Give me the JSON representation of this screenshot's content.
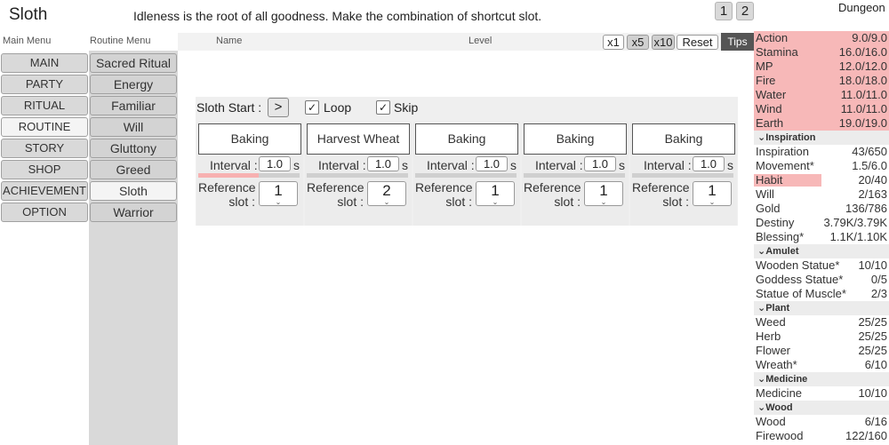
{
  "title": "Sloth",
  "description": "Idleness is the root of all goodness. Make the combination of shortcut slot.",
  "pages": [
    "1",
    "2"
  ],
  "location": "Dungeon",
  "header": {
    "name": "Name",
    "level": "Level",
    "speeds": [
      "x1",
      "x5",
      "x10"
    ],
    "reset": "Reset",
    "tips": "Tips"
  },
  "main_menu": {
    "title": "Main Menu",
    "items": [
      "MAIN",
      "PARTY",
      "RITUAL",
      "ROUTINE",
      "STORY",
      "SHOP",
      "ACHIEVEMENT",
      "OPTION"
    ],
    "active": "ROUTINE"
  },
  "routine_menu": {
    "title": "Routine Menu",
    "items": [
      "Sacred Ritual",
      "Energy",
      "Familiar",
      "Will",
      "Gluttony",
      "Greed",
      "Sloth",
      "Warrior"
    ],
    "active": "Sloth"
  },
  "sloth": {
    "start_label": "Sloth Start :",
    "start_button": ">",
    "loop_label": "Loop",
    "loop_checked": true,
    "skip_label": "Skip",
    "skip_checked": true,
    "interval_label": "Interval :",
    "unit": "s",
    "ref_label_1": "Reference",
    "ref_label_2": "slot :",
    "slots": [
      {
        "name": "Baking",
        "interval": "1.0",
        "ref": "1",
        "progress": 0.6
      },
      {
        "name": "Harvest Wheat",
        "interval": "1.0",
        "ref": "2",
        "progress": 0
      },
      {
        "name": "Baking",
        "interval": "1.0",
        "ref": "1",
        "progress": 0
      },
      {
        "name": "Baking",
        "interval": "1.0",
        "ref": "1",
        "progress": 0
      },
      {
        "name": "Baking",
        "interval": "1.0",
        "ref": "1",
        "progress": 0
      }
    ]
  },
  "stats": {
    "resources": [
      {
        "label": "Action",
        "value": "9.0/9.0"
      },
      {
        "label": "Stamina",
        "value": "16.0/16.0"
      },
      {
        "label": "MP",
        "value": "12.0/12.0"
      },
      {
        "label": "Fire",
        "value": "18.0/18.0"
      },
      {
        "label": "Water",
        "value": "11.0/11.0"
      },
      {
        "label": "Wind",
        "value": "11.0/11.0"
      },
      {
        "label": "Earth",
        "value": "19.0/19.0"
      }
    ],
    "inspiration_header": "Inspiration",
    "inspiration": [
      {
        "label": "Inspiration",
        "value": "43/650",
        "fill": 0
      },
      {
        "label": "Movement*",
        "value": "1.5/6.0",
        "fill": 0
      },
      {
        "label": "Habit",
        "value": "20/40",
        "fill": 0.5
      },
      {
        "label": "Will",
        "value": "2/163",
        "fill": 0
      },
      {
        "label": "Gold",
        "value": "136/786",
        "fill": 0
      },
      {
        "label": "Destiny",
        "value": "3.79K/3.79K",
        "fill": 0
      },
      {
        "label": "Blessing*",
        "value": "1.1K/1.10K",
        "fill": 0
      }
    ],
    "amulet_header": "Amulet",
    "amulet": [
      {
        "label": "Wooden Statue*",
        "value": "10/10"
      },
      {
        "label": "Goddess Statue*",
        "value": "0/5"
      },
      {
        "label": "Statue of Muscle*",
        "value": "2/3"
      }
    ],
    "plant_header": "Plant",
    "plant": [
      {
        "label": "Weed",
        "value": "25/25"
      },
      {
        "label": "Herb",
        "value": "25/25"
      },
      {
        "label": "Flower",
        "value": "25/25"
      },
      {
        "label": "Wreath*",
        "value": "6/10"
      }
    ],
    "medicine_header": "Medicine",
    "medicine": [
      {
        "label": "Medicine",
        "value": "10/10"
      }
    ],
    "wood_header": "Wood",
    "wood": [
      {
        "label": "Wood",
        "value": "6/16"
      },
      {
        "label": "Firewood",
        "value": "122/160"
      }
    ]
  },
  "colors": {
    "highlight": "#f7b8b8",
    "progress": "#f7b1b1",
    "tips_bg": "#555555"
  }
}
